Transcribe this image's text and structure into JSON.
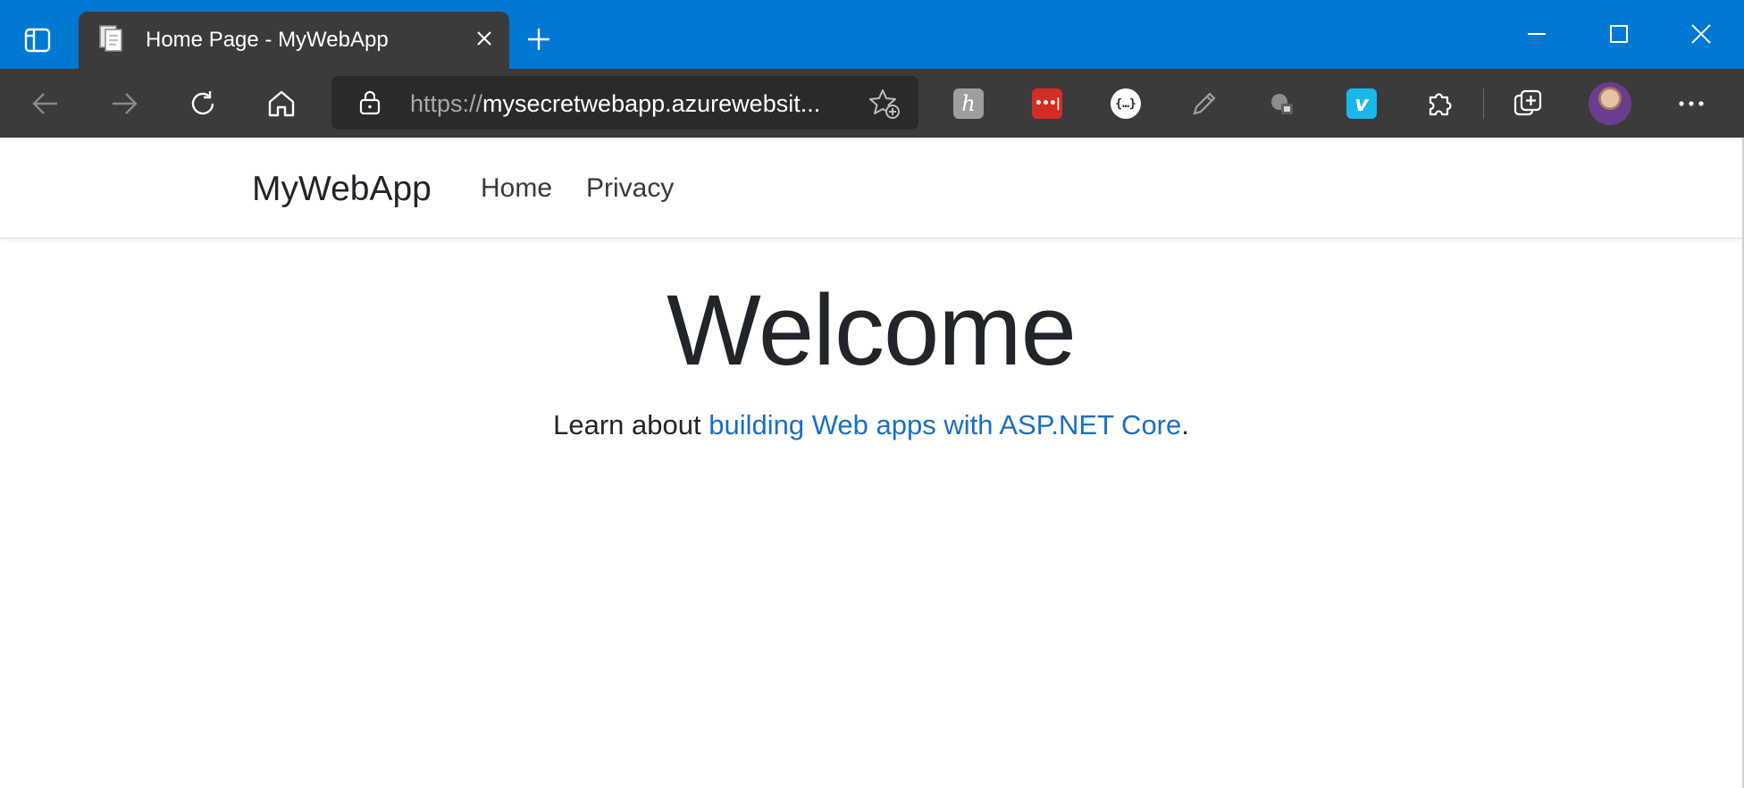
{
  "browser": {
    "tab_title": "Home Page - MyWebApp",
    "url_scheme": "https://",
    "url_rest": "mysecretwebapp.azurewebsit...",
    "colors": {
      "titlebar": "#0078d4",
      "toolbar": "#3b3b3b",
      "addressbar": "#2a2a2a"
    },
    "extensions": [
      {
        "name": "honey-extension-icon",
        "glyph": "h",
        "bg": "#9e9e9e"
      },
      {
        "name": "lastpass-extension-icon",
        "glyph": "•••|",
        "bg": "#d32d27"
      },
      {
        "name": "json-formatter-extension-icon",
        "glyph": "{…}",
        "bg": "#ffffff"
      },
      {
        "name": "pencil-extension-icon",
        "glyph": "",
        "bg": "transparent"
      },
      {
        "name": "office-extension-icon",
        "glyph": "",
        "bg": "transparent"
      },
      {
        "name": "vimeo-extension-icon",
        "glyph": "v",
        "bg": "#1ab7ea"
      }
    ]
  },
  "site": {
    "brand": "MyWebApp",
    "nav": [
      {
        "label": "Home"
      },
      {
        "label": "Privacy"
      }
    ]
  },
  "main": {
    "heading": "Welcome",
    "learn_prefix": "Learn about ",
    "learn_link": "building Web apps with ASP.NET Core",
    "learn_suffix": "."
  }
}
